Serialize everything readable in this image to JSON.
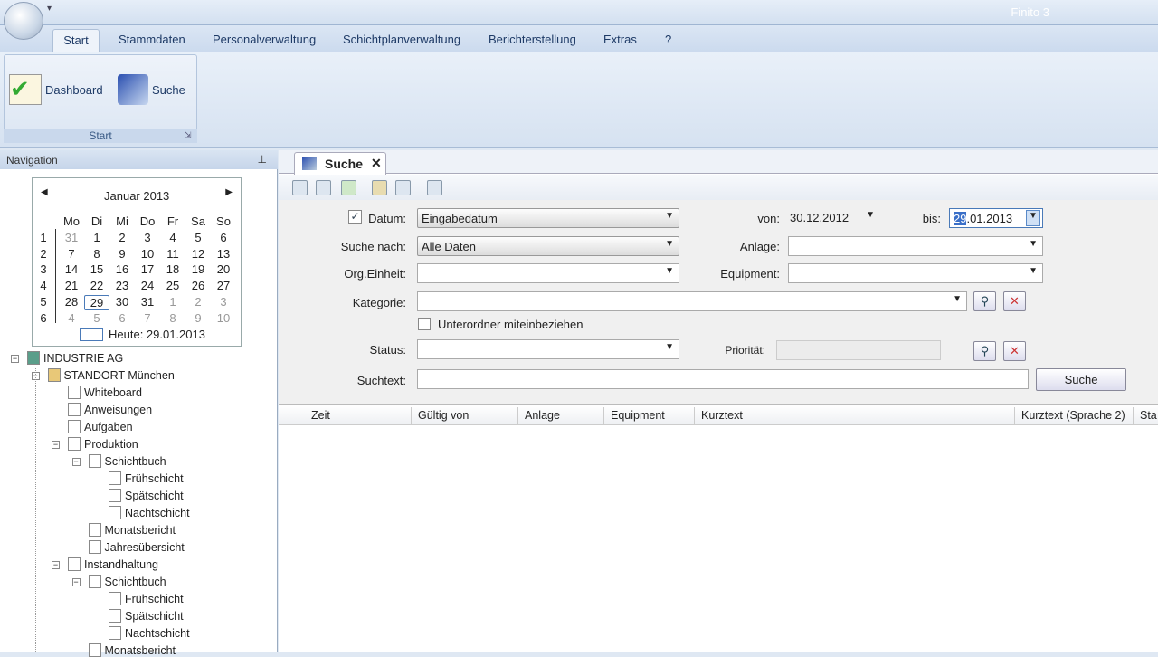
{
  "app": {
    "title": "Finito 3"
  },
  "ribbon": {
    "tabs": [
      "Start",
      "Stammdaten",
      "Personalverwaltung",
      "Schichtplanverwaltung",
      "Berichterstellung",
      "Extras",
      "?"
    ],
    "group_label": "Start",
    "buttons": {
      "dashboard": "Dashboard",
      "suche": "Suche"
    }
  },
  "navigation": {
    "title": "Navigation",
    "calendar": {
      "month": "Januar 2013",
      "weekdays": [
        "Mo",
        "Di",
        "Mi",
        "Do",
        "Fr",
        "Sa",
        "So"
      ],
      "weeks": [
        [
          "1",
          "31",
          "1",
          "2",
          "3",
          "4",
          "5",
          "6"
        ],
        [
          "2",
          "7",
          "8",
          "9",
          "10",
          "11",
          "12",
          "13"
        ],
        [
          "3",
          "14",
          "15",
          "16",
          "17",
          "18",
          "19",
          "20"
        ],
        [
          "4",
          "21",
          "22",
          "23",
          "24",
          "25",
          "26",
          "27"
        ],
        [
          "5",
          "28",
          "29",
          "30",
          "31",
          "1",
          "2",
          "3"
        ],
        [
          "6",
          "4",
          "5",
          "6",
          "7",
          "8",
          "9",
          "10"
        ]
      ],
      "today": "Heute: 29.01.2013"
    },
    "tree": [
      {
        "label": "INDUSTRIE AG",
        "level": 0
      },
      {
        "label": "STANDORT München",
        "level": 1
      },
      {
        "label": "Whiteboard",
        "level": 2
      },
      {
        "label": "Anweisungen",
        "level": 2
      },
      {
        "label": "Aufgaben",
        "level": 2
      },
      {
        "label": "Produktion",
        "level": 2
      },
      {
        "label": "Schichtbuch",
        "level": 3
      },
      {
        "label": "Frühschicht",
        "level": 4
      },
      {
        "label": "Spätschicht",
        "level": 4
      },
      {
        "label": "Nachtschicht",
        "level": 4
      },
      {
        "label": "Monatsbericht",
        "level": 3
      },
      {
        "label": "Jahresübersicht",
        "level": 3
      },
      {
        "label": "Instandhaltung",
        "level": 2
      },
      {
        "label": "Schichtbuch",
        "level": 3
      },
      {
        "label": "Frühschicht",
        "level": 4
      },
      {
        "label": "Spätschicht",
        "level": 4
      },
      {
        "label": "Nachtschicht",
        "level": 4
      },
      {
        "label": "Monatsbericht",
        "level": 3
      }
    ]
  },
  "document": {
    "tab": "Suche",
    "form": {
      "datum_label": "Datum:",
      "datum_value": "Eingabedatum",
      "suche_nach_label": "Suche nach:",
      "suche_nach_value": "Alle Daten",
      "org_label": "Org.Einheit:",
      "kategorie_label": "Kategorie:",
      "unterordner_label": "Unterordner miteinbeziehen",
      "status_label": "Status:",
      "suchtext_label": "Suchtext:",
      "von_label": "von:",
      "von_value": "30.12.2012",
      "bis_label": "bis:",
      "bis_sel": "29",
      "bis_rest": ".01.2013",
      "anlage_label": "Anlage:",
      "equipment_label": "Equipment:",
      "prioritaet_label": "Priorität:",
      "search_button": "Suche"
    },
    "grid_columns": [
      "Zeit",
      "Gültig von",
      "Anlage",
      "Equipment",
      "Kurztext",
      "Kurztext (Sprache 2)",
      "Sta"
    ]
  }
}
